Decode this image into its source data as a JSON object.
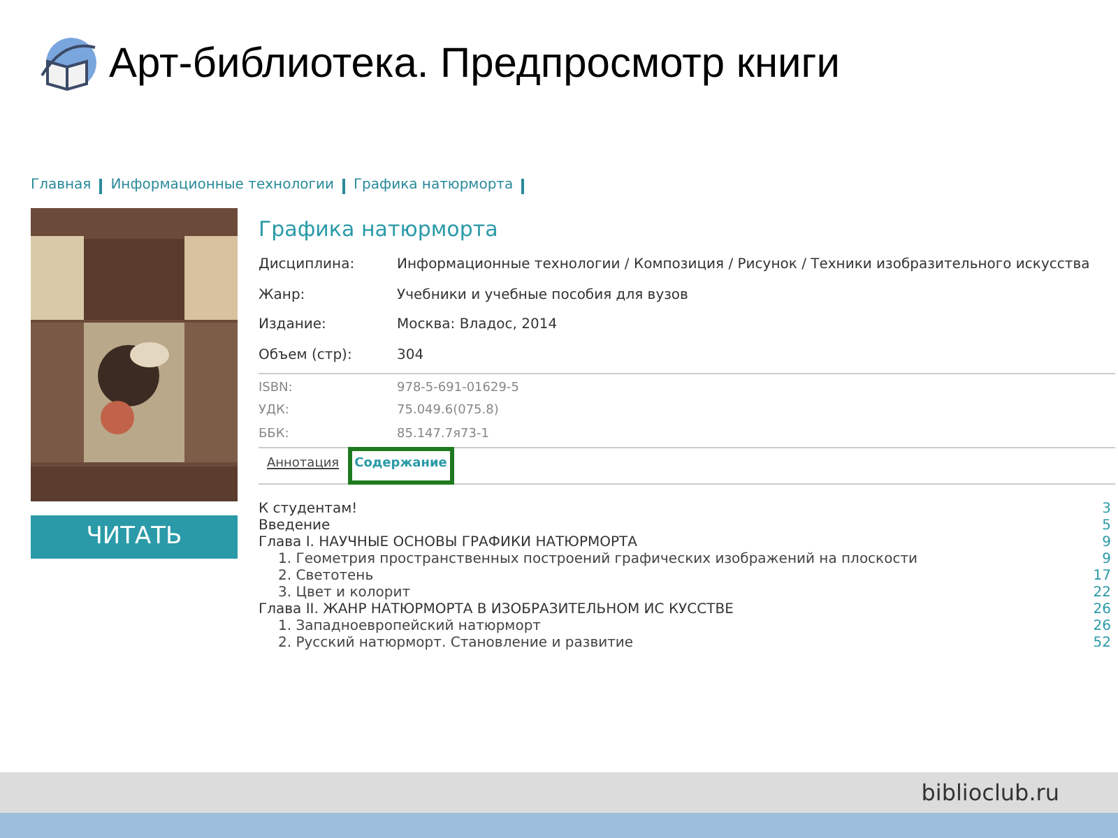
{
  "slide_title": "Арт-библиотека. Предпросмотр книги",
  "breadcrumbs": [
    "Главная",
    "Информационные технологии",
    "Графика натюрморта"
  ],
  "cover": {
    "kind": "picture"
  },
  "read_button": "ЧИТАТЬ",
  "book_title": "Графика натюрморта",
  "details": [
    {
      "label": "Дисциплина:",
      "value": "Информационные технологии / Композиция / Рисунок / Техники изобразительного искусства"
    },
    {
      "label": "Жанр:",
      "value": "Учебники и учебные пособия для вузов"
    },
    {
      "label": "Издание:",
      "value": "Москва: Владос, 2014"
    },
    {
      "label": "Объем (стр):",
      "value": "304"
    }
  ],
  "codes": [
    {
      "label": "ISBN:",
      "value": "978-5-691-01629-5"
    },
    {
      "label": "УДК:",
      "value": "75.049.6(075.8)"
    },
    {
      "label": "ББК:",
      "value": "85.147.7я73-1"
    }
  ],
  "tabs": [
    {
      "label": "Аннотация",
      "selected": false
    },
    {
      "label": "Содержание",
      "selected": true
    }
  ],
  "contents": [
    {
      "title": "К студентам!",
      "page": "3"
    },
    {
      "title": "Введение",
      "page": "5"
    },
    {
      "title": "Глава I. НАУЧНЫЕ ОСНОВЫ ГРАФИКИ НАТЮРМОРТА",
      "page": "9",
      "children": [
        {
          "title": "1. Геометрия пространственных построений графических изображений на плоскости",
          "page": "9"
        },
        {
          "title": "2. Светотень",
          "page": "17"
        },
        {
          "title": "3. Цвет и колорит",
          "page": "22"
        }
      ]
    },
    {
      "title": "Глава II. ЖАНР НАТЮРМОРТА В ИЗОБРАЗИТЕЛЬНОМ ИС КУССТВЕ",
      "page": "26",
      "children": [
        {
          "title": "1. Западноевропейский натюрморт",
          "page": "26"
        },
        {
          "title": "2. Русский натюрморт. Становление и развитие",
          "page": "52"
        }
      ]
    }
  ],
  "footer": "biblioclub.ru"
}
